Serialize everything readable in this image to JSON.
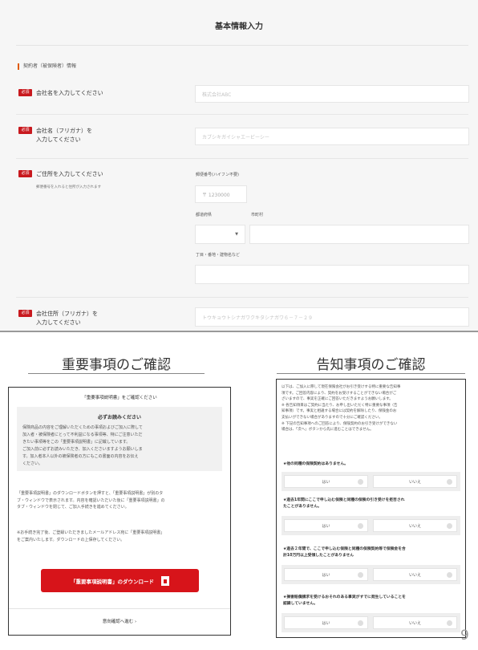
{
  "form": {
    "title": "基本情報入力",
    "section_label": "契約者（被保険者）情報",
    "required_badge": "必須",
    "company_name": {
      "label": "会社名を入力してください",
      "placeholder": "株式会社ABC"
    },
    "company_kana": {
      "label_line1": "会社名（フリガナ）を",
      "label_line2": "入力してください",
      "placeholder": "カブシキガイシャエービーシー"
    },
    "address": {
      "label": "ご住所を入力してください",
      "note": "郵便番号を入れると住所が入力されます",
      "postal_label": "郵便番号(ハイフン不要)",
      "postal_placeholder": "〒 1230000",
      "prefecture_label": "都道府県",
      "city_label": "市町村",
      "street_label": "丁目・番地・建物名など"
    },
    "address_kana": {
      "label_line1": "会社住所（フリガナ）を",
      "label_line2": "入力してください",
      "placeholder": "トウキョウトシナガワクキタシナガワ６－７－２９"
    }
  },
  "left_panel": {
    "title": "重要事項のご確認",
    "header": "「重要事項説明書」をご確認ください",
    "must_read_title": "必ずお読みください",
    "must_read_lines": [
      "保険商品の内容をご理解いただくための事項およびご加入に際して",
      "加入者・被保険者にとって不利益になる事項等、特にご注意いただ",
      "きたい事項等をこの「重要事項説明書」に記載しています。",
      "ご加入前に必ずお読みいただき、加入くださいますようお願いしま",
      "す。加入者本人以外の被保険者の方にもこの書面の内容をお伝え",
      "ください。"
    ],
    "para1_lines": [
      "「重要事項説明書」のダウンロードボタンを押すと、「重要事項説明書」が別のタ",
      "ブ・ウィンドウで表示されます。内容を確認いただいた後に「重要事項説明書」の",
      "タブ・ウィンドウを閉じて、ご加入手続きを進めてください。"
    ],
    "para2_lines": [
      "※お手続き完了後、ご登録いただきましたメールアドレス宛に「重要事項説明書」",
      "をご案内いたします。ダウンロードの上保存してください。"
    ],
    "download_button": "「重要事項説明書」のダウンロード",
    "next_link": "意向確認へ進む ›"
  },
  "right_panel": {
    "title": "告知事項のご確認",
    "intro_lines": [
      "以下は、ご加入に際して現在保険会社がお引き受けする特に重要な告知事",
      "項です。ご回答内容により、契約をお受けすることができない場合がご",
      "ざいますので、事実を正確にご回答いただきますようお願いします。",
      "※ 各告知項目はご契約に当たり、お申し出いただく特に重要な事項（告",
      "知事項）です。事実と相違する場合には契約を解除したり、保険金のお",
      "支払いができない場合がありますので十分にご確認ください。",
      "※ 下記の告知事項へのご回答により、保険契約のお引き受けができない",
      "場合は、「次へ」ボタンから先に進むことはできません。"
    ],
    "questions": [
      "★他の同種の保険契約はありません。",
      "★過去1年間にここで申し込む保険と同種の保険の引き受けを拒否され\nたことがありません。",
      "★過去２年間で、ここで申し込む保険と同種の保険契約等で保険金を合\n計10万円以上受領したことがありません",
      "★損害賠償請求を受けるおそれのある事実がすでに発生していることを\n認識していません。"
    ],
    "yes_label": "はい",
    "no_label": "いいえ"
  },
  "page_number": "9"
}
